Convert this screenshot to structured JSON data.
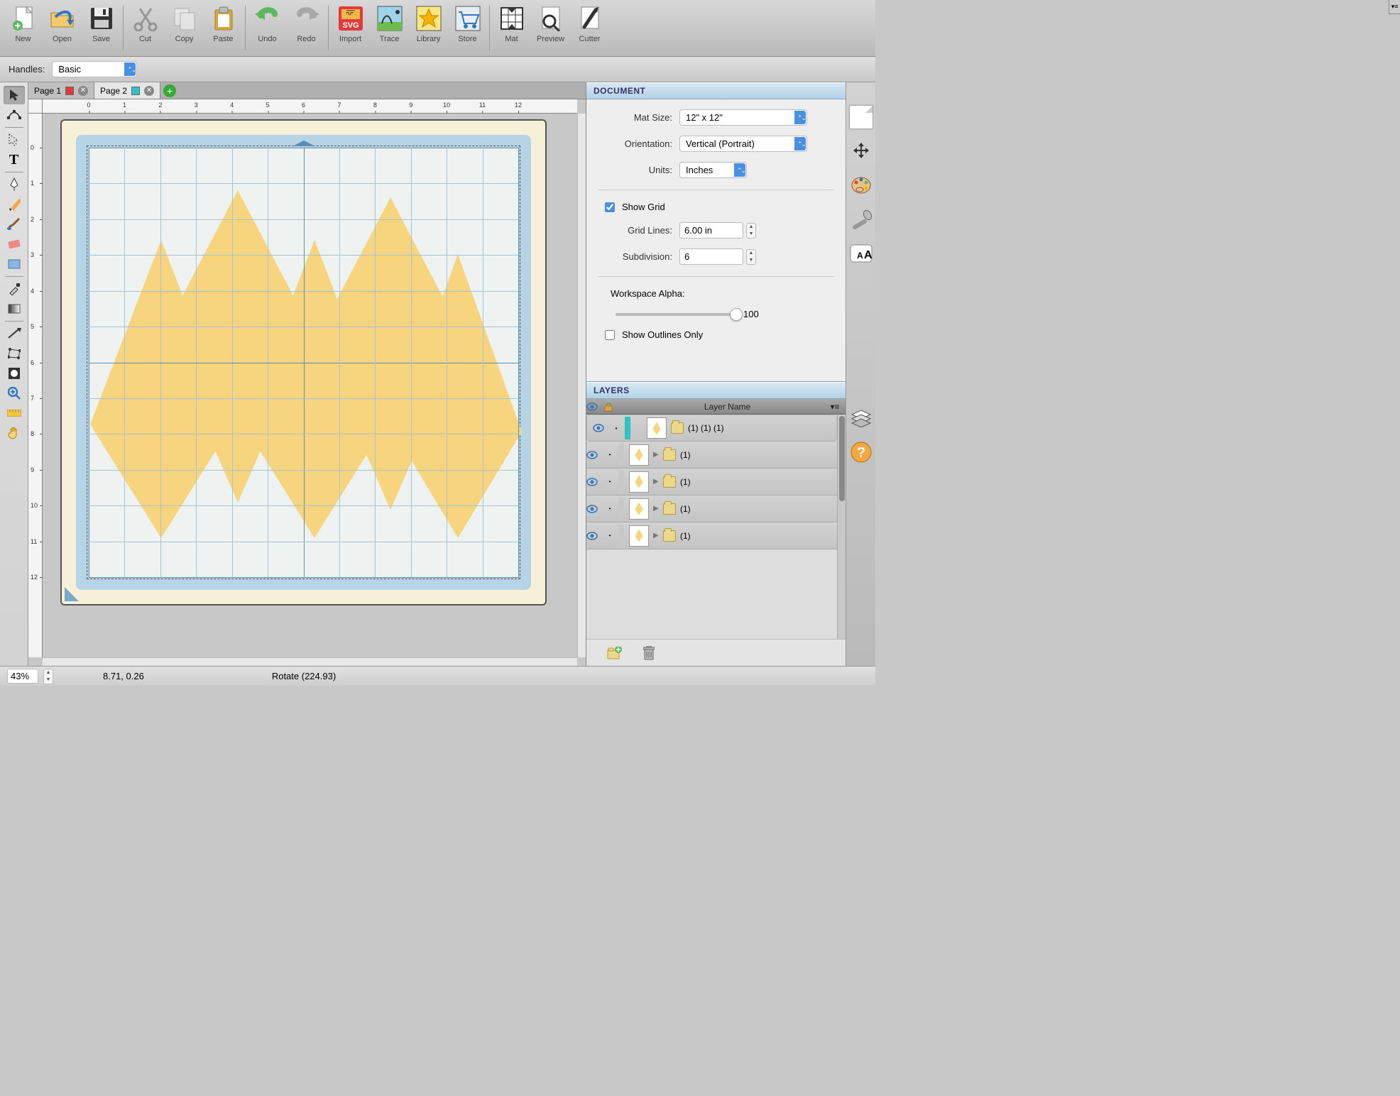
{
  "toolbar": [
    {
      "id": "new",
      "label": "New"
    },
    {
      "id": "open",
      "label": "Open"
    },
    {
      "id": "save",
      "label": "Save"
    },
    {
      "sep": true
    },
    {
      "id": "cut",
      "label": "Cut"
    },
    {
      "id": "copy",
      "label": "Copy"
    },
    {
      "id": "paste",
      "label": "Paste"
    },
    {
      "sep": true
    },
    {
      "id": "undo",
      "label": "Undo"
    },
    {
      "id": "redo",
      "label": "Redo"
    },
    {
      "sep": true
    },
    {
      "id": "import",
      "label": "Import"
    },
    {
      "id": "trace",
      "label": "Trace"
    },
    {
      "id": "library",
      "label": "Library"
    },
    {
      "id": "store",
      "label": "Store"
    },
    {
      "sep": true
    },
    {
      "id": "mat",
      "label": "Mat"
    },
    {
      "id": "preview",
      "label": "Preview"
    },
    {
      "id": "cutter",
      "label": "Cutter"
    }
  ],
  "options": {
    "handles_label": "Handles:",
    "handles_value": "Basic"
  },
  "tabs": [
    {
      "name": "Page 1",
      "color": "#e23b3b",
      "active": false
    },
    {
      "name": "Page 2",
      "color": "#2ec4c4",
      "active": true
    }
  ],
  "ruler_ticks_h": [
    0,
    1,
    2,
    3,
    4,
    5,
    6,
    7,
    8,
    9,
    10,
    11,
    12
  ],
  "ruler_ticks_v": [
    0,
    1,
    2,
    3,
    4,
    5,
    6,
    7,
    8,
    9,
    10,
    11,
    12
  ],
  "document": {
    "title": "DOCUMENT",
    "mat_size_label": "Mat Size:",
    "mat_size_value": "12\" x 12\"",
    "orientation_label": "Orientation:",
    "orientation_value": "Vertical (Portrait)",
    "units_label": "Units:",
    "units_value": "Inches",
    "show_grid_label": "Show Grid",
    "show_grid_checked": true,
    "grid_lines_label": "Grid Lines:",
    "grid_lines_value": "6.00 in",
    "subdivision_label": "Subdivision:",
    "subdivision_value": "6",
    "workspace_alpha_label": "Workspace Alpha:",
    "workspace_alpha_value": "100",
    "outlines_label": "Show Outlines Only",
    "outlines_checked": false
  },
  "layers": {
    "title": "LAYERS",
    "header": "Layer Name",
    "rows": [
      {
        "name": "(1) (1) (1)",
        "selected": true,
        "expandable": false
      },
      {
        "name": "(1)",
        "selected": false,
        "expandable": true
      },
      {
        "name": "(1)",
        "selected": false,
        "expandable": true
      },
      {
        "name": "(1)",
        "selected": false,
        "expandable": true
      },
      {
        "name": "(1)",
        "selected": false,
        "expandable": true
      }
    ]
  },
  "status": {
    "zoom": "43%",
    "coords": "8.71, 0.26",
    "mode": "Rotate (224.93)"
  }
}
